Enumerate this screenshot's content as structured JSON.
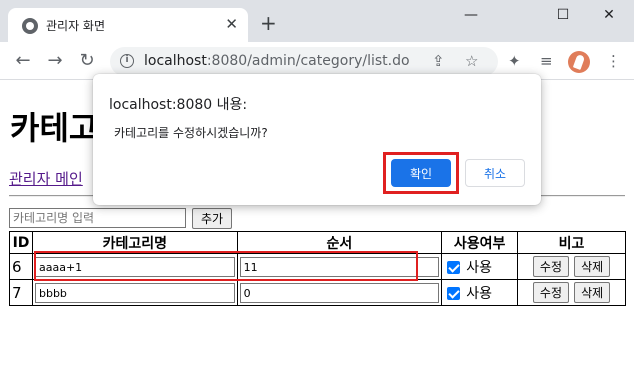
{
  "browser": {
    "tab_title": "관리자 화면",
    "tab_close": "✕",
    "new_tab": "+",
    "url_host": "localhost",
    "url_rest": ":8080/admin/category/list.do",
    "win_minimize": "—",
    "win_maximize": "☐",
    "win_close": "✕"
  },
  "page": {
    "title": "카테고리 관리",
    "admin_main_link": "관리자 메인",
    "new_category_placeholder": "카테고리명 입력",
    "add_button": "추가"
  },
  "table": {
    "headers": [
      "ID",
      "카테고리명",
      "순서",
      "사용여부",
      "비고"
    ],
    "use_label": "사용",
    "edit_label": "수정",
    "delete_label": "삭제",
    "rows": [
      {
        "id": "6",
        "name": "aaaa+1",
        "order": "11",
        "used": true
      },
      {
        "id": "7",
        "name": "bbbb",
        "order": "0",
        "used": true
      }
    ]
  },
  "dialog": {
    "title": "localhost:8080 내용:",
    "message": "카테고리를 수정하시겠습니까?",
    "ok_label": "확인",
    "cancel_label": "취소"
  },
  "colors": {
    "accent": "#1a73e8",
    "highlight": "#e02020",
    "checkbox": "#0075ff",
    "visited_link": "#551a8b"
  }
}
